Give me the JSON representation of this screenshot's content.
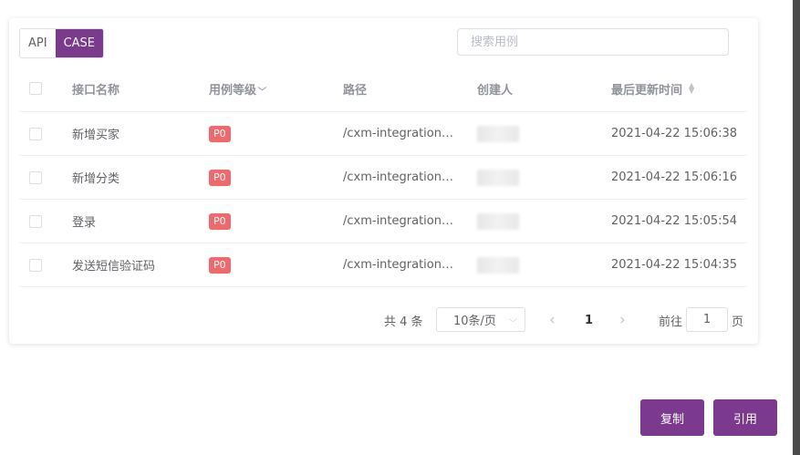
{
  "tabs": [
    {
      "label": "API",
      "active": false
    },
    {
      "label": "CASE",
      "active": true
    }
  ],
  "search": {
    "placeholder": "搜索用例",
    "value": ""
  },
  "table": {
    "headers": {
      "name": "接口名称",
      "level": "用例等级",
      "path": "路径",
      "creator": "创建人",
      "updated": "最后更新时间"
    },
    "rows": [
      {
        "name": "新增买家",
        "level": "P0",
        "path": "/cxm-integrationApi/buyer/add",
        "updated": "2021-04-22 15:06:38"
      },
      {
        "name": "新增分类",
        "level": "P0",
        "path": "/cxm-integrationApi/category/add",
        "updated": "2021-04-22 15:06:16"
      },
      {
        "name": "登录",
        "level": "P0",
        "path": "/cxm-integrationApi/login",
        "updated": "2021-04-22 15:05:54"
      },
      {
        "name": "发送短信验证码",
        "level": "P0",
        "path": "/cxm-integrationApi/sms/send",
        "updated": "2021-04-22 15:04:35"
      }
    ]
  },
  "pagination": {
    "total_text": "共 4 条",
    "page_size": "10条/页",
    "prev": "‹",
    "current": "1",
    "next": "›",
    "goto_prefix": "前往",
    "goto_value": "1",
    "goto_suffix": "页"
  },
  "buttons": {
    "copy": "复制",
    "quote": "引用"
  },
  "colors": {
    "accent": "#7b3a8e",
    "badge": "#f0696c"
  }
}
